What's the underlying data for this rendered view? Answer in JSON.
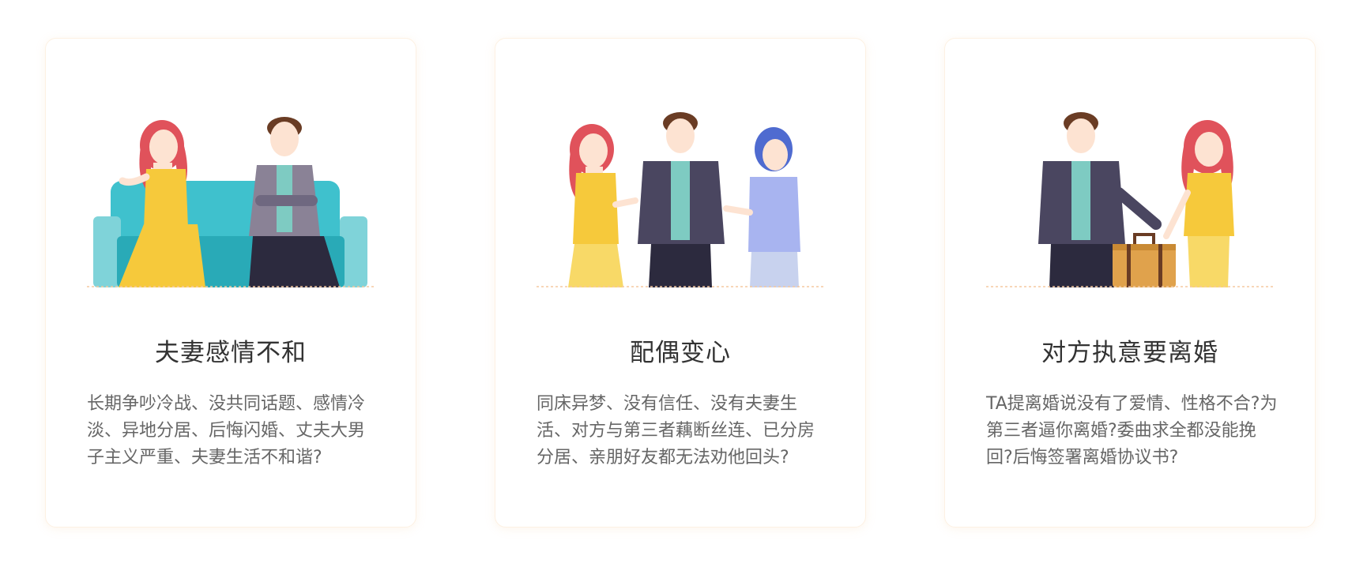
{
  "cards": [
    {
      "title": "夫妻感情不和",
      "description": "长期争吵冷战、没共同话题、感情冷淡、异地分居、后悔闪婚、丈夫大男子主义严重、夫妻生活不和谐?",
      "illustration": "couple-on-sofa-illustration"
    },
    {
      "title": "配偶变心",
      "description": "同床异梦、没有信任、没有夫妻生活、对方与第三者藕断丝连、已分房分居、亲朋好友都无法劝他回头?",
      "illustration": "love-triangle-illustration"
    },
    {
      "title": "对方执意要离婚",
      "description": "TA提离婚说没有了爱情、性格不合?为第三者逼你离婚?委曲求全都没能挽回?后悔签署离婚协议书?",
      "illustration": "woman-leaving-with-suitcase-illustration"
    }
  ],
  "colors": {
    "title": "#333333",
    "text": "#666666",
    "card_border": "#fdf1e3",
    "baseline": "#f5c9a0"
  }
}
